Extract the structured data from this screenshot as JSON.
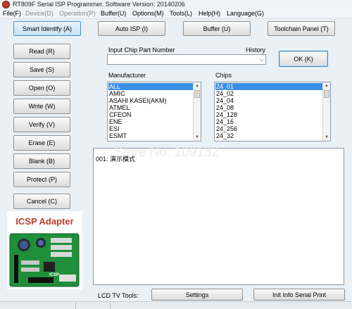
{
  "window": {
    "title": "RT809F Serial ISP Programmer. Software Version: 20140206"
  },
  "menu": [
    {
      "label": "File(F)",
      "enabled": true
    },
    {
      "label": "Device(D)",
      "enabled": false
    },
    {
      "label": "Operation(P)",
      "enabled": false
    },
    {
      "label": "Buffer(U)",
      "enabled": true
    },
    {
      "label": "Options(M)",
      "enabled": true
    },
    {
      "label": "Tools(L)",
      "enabled": true
    },
    {
      "label": "Help(H)",
      "enabled": true
    },
    {
      "label": "Language(G)",
      "enabled": true
    }
  ],
  "toolbar": {
    "smart_identify": "Smart Identify (A)",
    "auto_isp": "Auto ISP (I)",
    "buffer": "Buffer (U)",
    "toolchain_panel": "Toolchain Panel (T)"
  },
  "side_buttons": [
    {
      "label": "Read (R)"
    },
    {
      "label": "Save (S)"
    },
    {
      "label": "Open (O)"
    },
    {
      "label": "Write  (W)"
    },
    {
      "label": "Verify (V)"
    },
    {
      "label": "Erase (E)"
    },
    {
      "label": "Blank (B)"
    },
    {
      "label": "Protect (P)"
    }
  ],
  "cancel_button": "Cancel (C)",
  "chip_input": {
    "label": "Input Chip Part Number",
    "history_label": "History",
    "value": ""
  },
  "ok_button": "OK (K)",
  "manufacturer": {
    "label": "Manufacturer",
    "items": [
      "ALL",
      "AMIC",
      "ASAHI KASEI(AKM)",
      "ATMEL",
      "CFEON",
      "ENE",
      "ESI",
      "ESMT"
    ],
    "selected": "ALL"
  },
  "chips": {
    "label": "Chips",
    "items": [
      "24_01",
      "24_02",
      "24_04",
      "24_08",
      "24_128",
      "24_16",
      "24_256",
      "24_32"
    ],
    "selected": "24_01"
  },
  "console": {
    "lines": [
      "001: 演示模式"
    ]
  },
  "watermark": "Store No: 109132",
  "adapter_image": {
    "title": "ICSP Adapter",
    "board_text": "ICSP"
  },
  "bottom": {
    "lcd_label": "LCD TV Tools:",
    "settings": "Settings",
    "init_info": "Init Info Serial Print"
  },
  "colors": {
    "background": "#eaf1f6",
    "selection": "#3a8ee6",
    "pcb_green": "#1f8f3a",
    "adapter_title": "#c0392b"
  }
}
